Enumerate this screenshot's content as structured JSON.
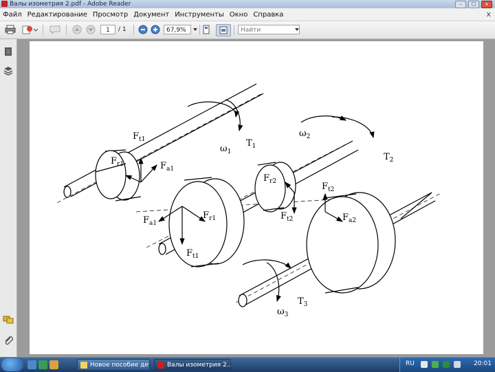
{
  "window": {
    "title": "Валы изометрия 2.pdf - Adobe Reader",
    "btn_min": "–",
    "btn_max": "□",
    "btn_close": "x"
  },
  "menu": {
    "items": [
      "Файл",
      "Редактирование",
      "Просмотр",
      "Документ",
      "Инструменты",
      "Окно",
      "Справка"
    ],
    "close_glyph": "x"
  },
  "toolbar": {
    "page_current": "1",
    "page_total": "/ 1",
    "zoom": "67,9%",
    "find_placeholder": "Найти"
  },
  "figure": {
    "labels": {
      "Ft1": "F",
      "Ft1_sub": "t1",
      "Fr1_top": "F",
      "Fr1_top_sub": "r1",
      "Fa1_top": "F",
      "Fa1_top_sub": "a1",
      "w1": "ω",
      "w1_sub": "1",
      "T1": "T",
      "T1_sub": "1",
      "w2": "ω",
      "w2_sub": "2",
      "T2": "T",
      "T2_sub": "2",
      "Fr2": "F",
      "Fr2_sub": "r2",
      "Ft2_left": "F",
      "Ft2_left_sub": "t2",
      "Ft2_right": "F",
      "Ft2_right_sub": "t2",
      "Fa2": "F",
      "Fa2_sub": "a2",
      "Fa1_bot": "F",
      "Fa1_bot_sub": "a1",
      "Fr1_bot": "F",
      "Fr1_bot_sub": "r1",
      "Ft1_bot": "F",
      "Ft1_bot_sub": "t1",
      "T3": "T",
      "T3_sub": "3",
      "w3": "ω",
      "w3_sub": "3"
    }
  },
  "taskbar": {
    "tasks": [
      "Новое пособие дет...",
      "Валы изометрия 2...."
    ],
    "lang": "RU",
    "clock": "20:01"
  },
  "colors": {
    "taskbar": "#1d3d66",
    "reader_red": "#c8201e",
    "page": "#ffffff"
  }
}
